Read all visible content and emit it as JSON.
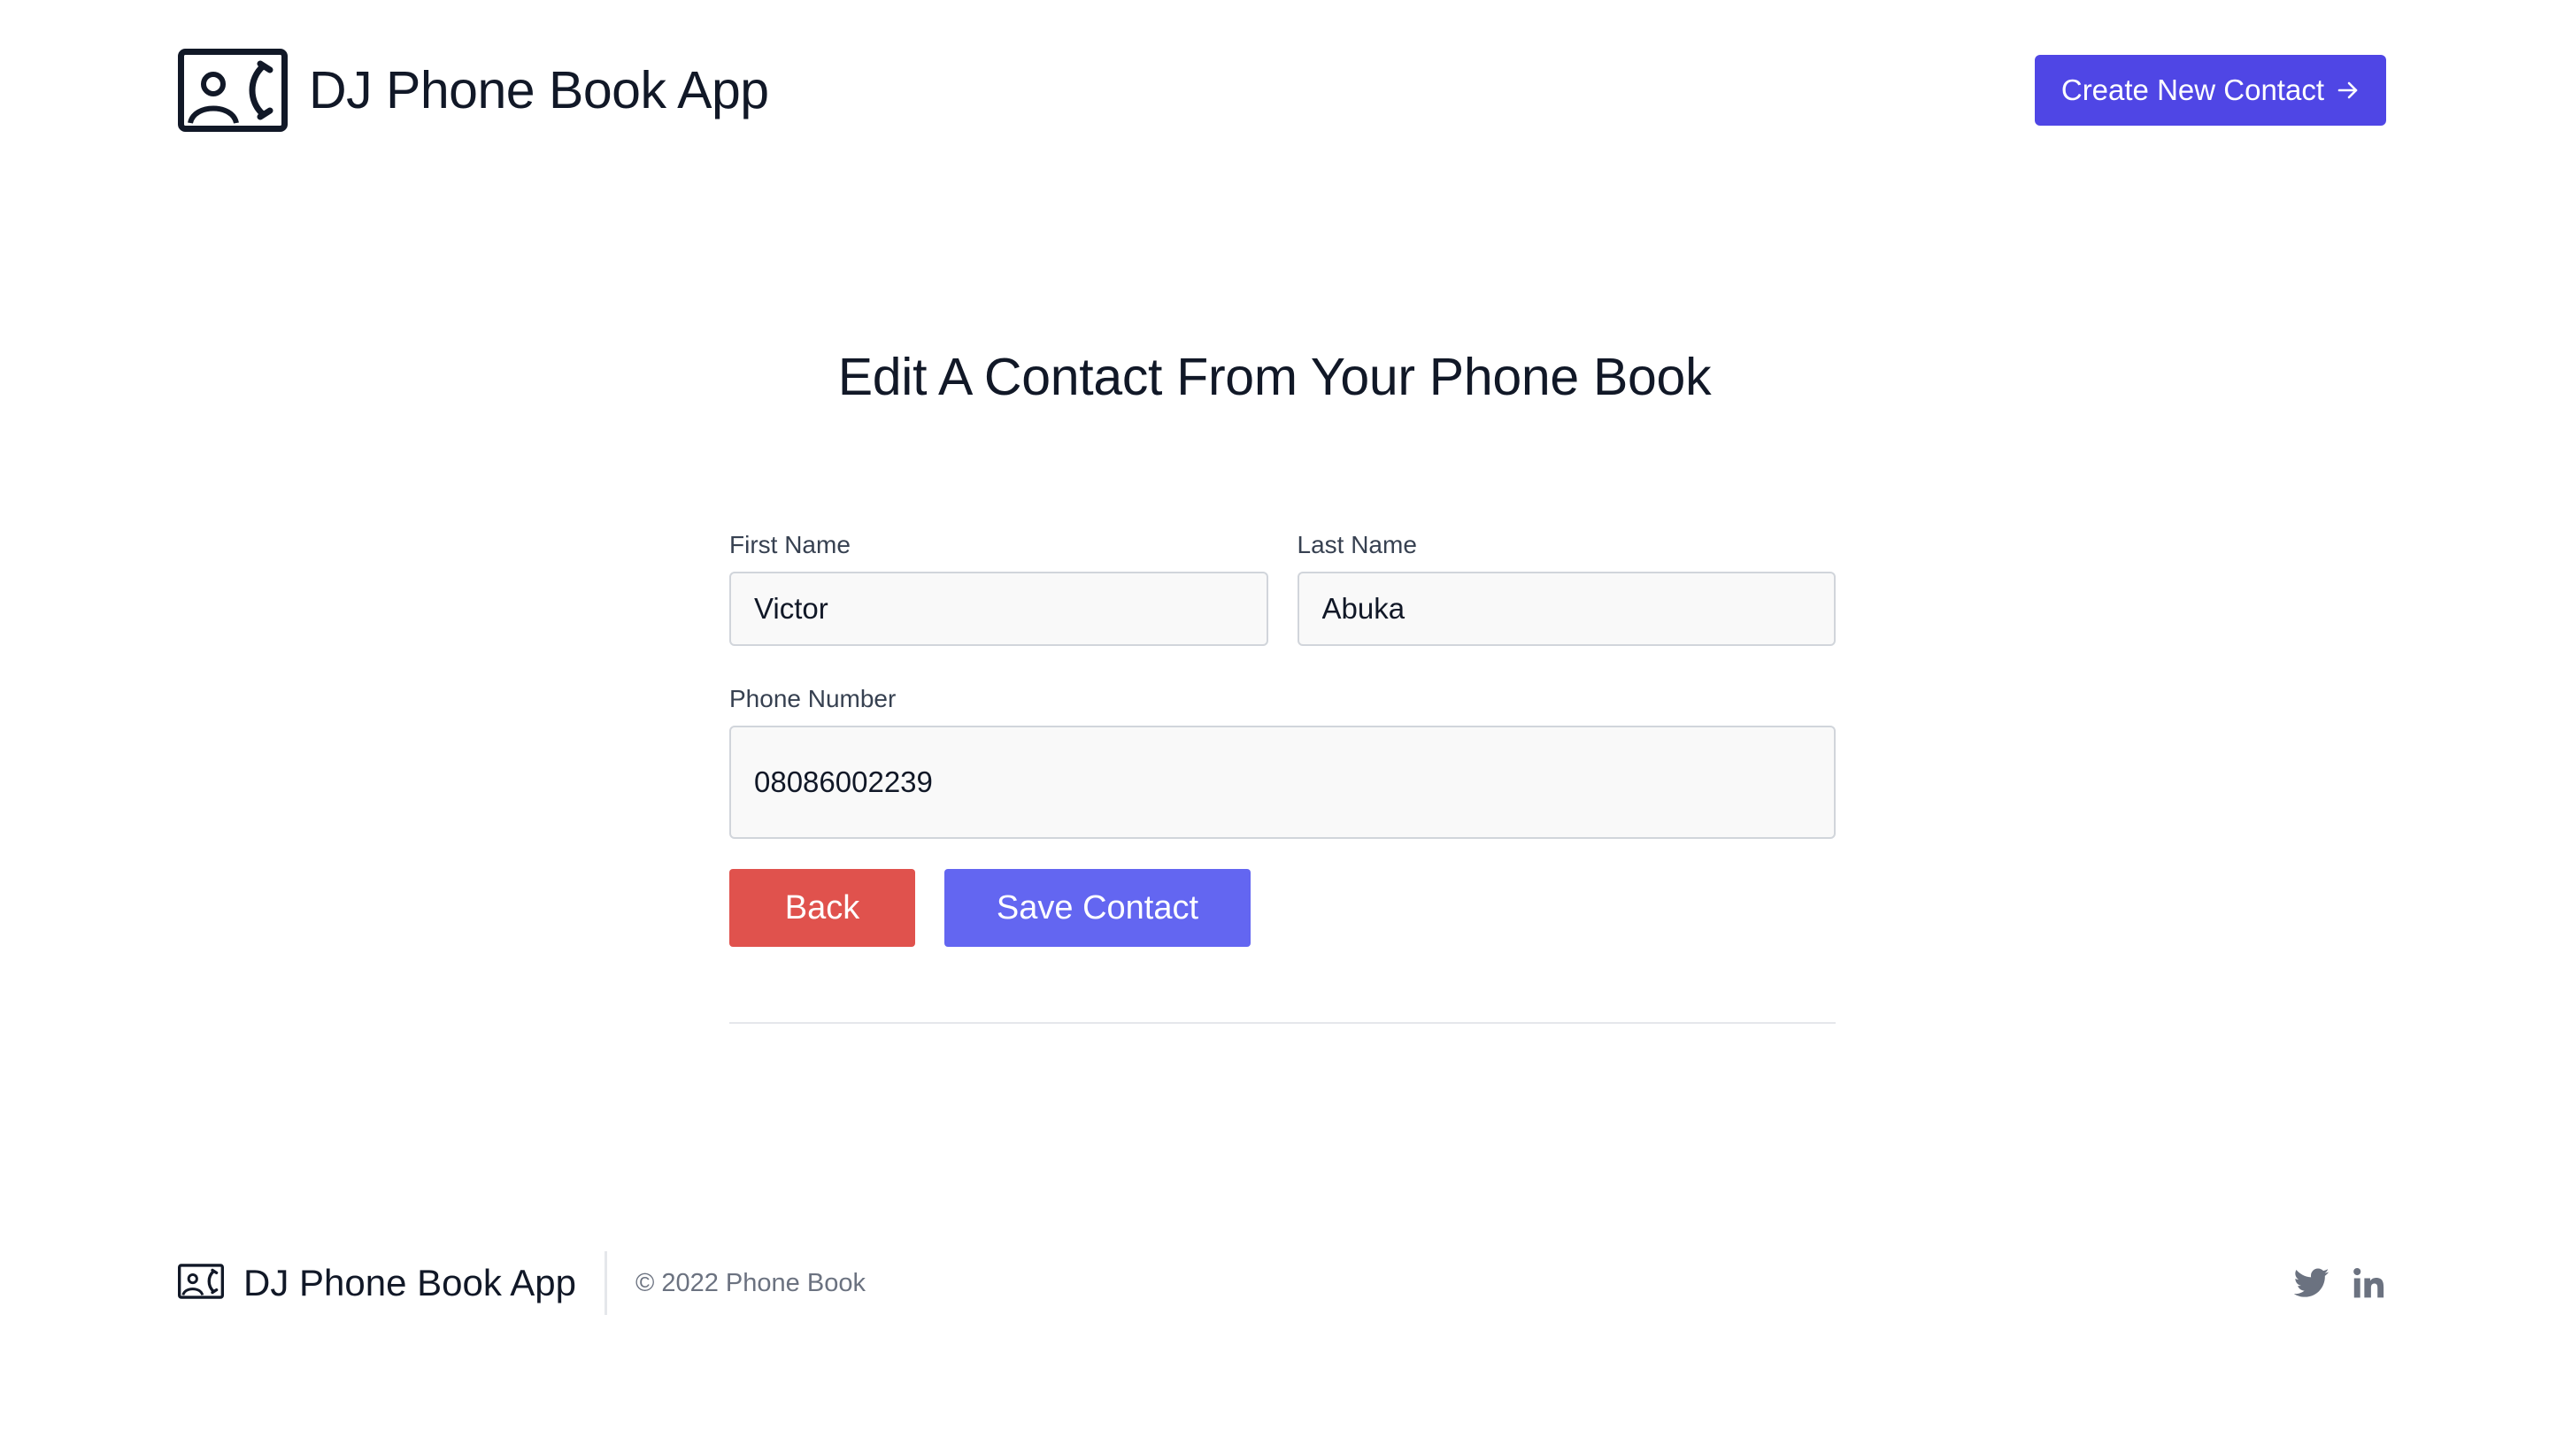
{
  "header": {
    "brand_title": "DJ Phone Book App",
    "brand_icon": "contact-card-phone-icon",
    "create_button_label": "Create New Contact",
    "create_button_icon": "arrow-right-icon",
    "accent_color": "#4f46e5"
  },
  "main": {
    "title": "Edit A Contact From Your Phone Book",
    "form": {
      "first_name": {
        "label": "First Name",
        "value": "Victor"
      },
      "last_name": {
        "label": "Last Name",
        "value": "Abuka"
      },
      "phone_number": {
        "label": "Phone Number",
        "value": "08086002239"
      }
    },
    "buttons": {
      "back_label": "Back",
      "back_color": "#e0524d",
      "save_label": "Save Contact",
      "save_color": "#6366f1"
    }
  },
  "footer": {
    "brand_title": "DJ Phone Book App",
    "copyright": "© 2022 Phone Book",
    "social_icons": [
      "twitter-icon",
      "linkedin-icon"
    ]
  }
}
